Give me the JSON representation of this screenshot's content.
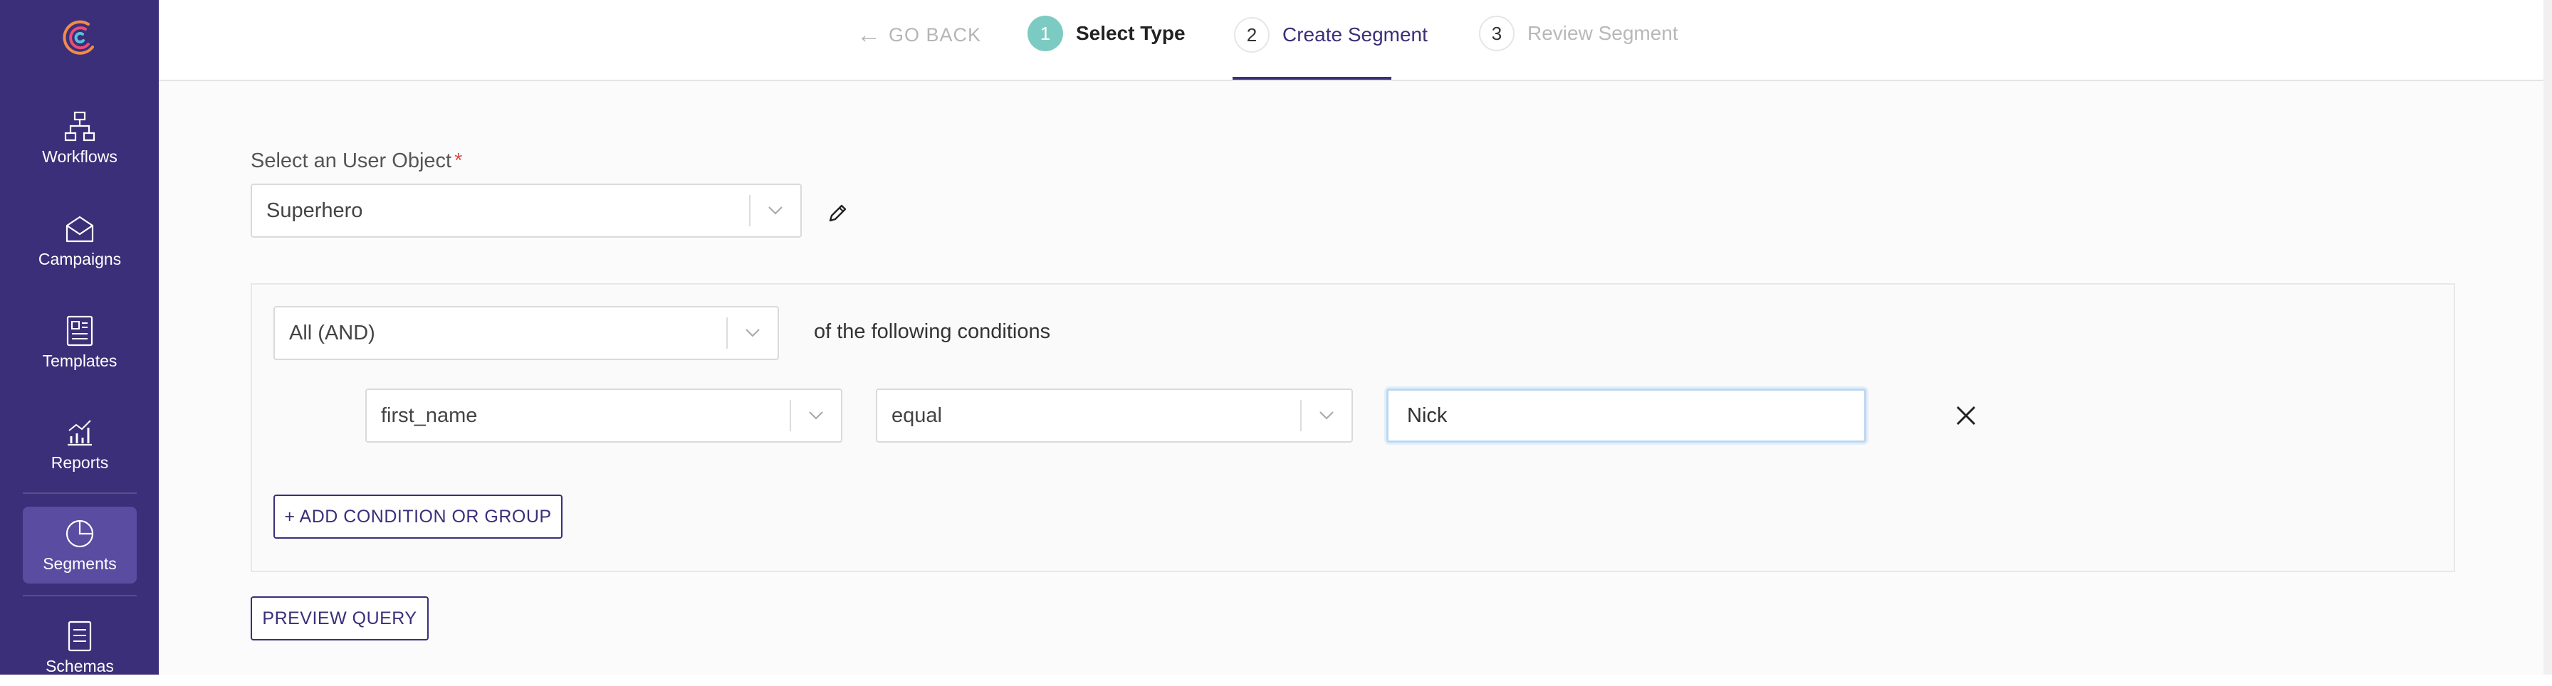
{
  "sidebar": {
    "items": [
      {
        "label": "Workflows",
        "icon": "workflow-icon"
      },
      {
        "label": "Campaigns",
        "icon": "mail-icon"
      },
      {
        "label": "Templates",
        "icon": "template-icon"
      },
      {
        "label": "Reports",
        "icon": "chart-icon"
      },
      {
        "label": "Segments",
        "icon": "pie-chart-icon",
        "active": true
      },
      {
        "label": "Schemas",
        "icon": "document-icon"
      }
    ]
  },
  "header": {
    "go_back": "GO BACK",
    "steps": [
      {
        "number": "1",
        "label": "Select Type"
      },
      {
        "number": "2",
        "label": "Create Segment"
      },
      {
        "number": "3",
        "label": "Review Segment"
      }
    ]
  },
  "form": {
    "user_object_label": "Select an User Object",
    "required_mark": "*",
    "user_object_value": "Superhero",
    "match_value": "All (AND)",
    "match_suffix": "of the following conditions",
    "condition": {
      "field": "first_name",
      "operator": "equal",
      "value": "Nick"
    },
    "add_condition_label": "+ ADD CONDITION OR GROUP",
    "preview_label": "PREVIEW QUERY"
  },
  "colors": {
    "sidebar_bg": "#3b2f79",
    "accent": "#3b2f79",
    "step_active": "#7ccbc2",
    "required": "#e04b4b"
  }
}
